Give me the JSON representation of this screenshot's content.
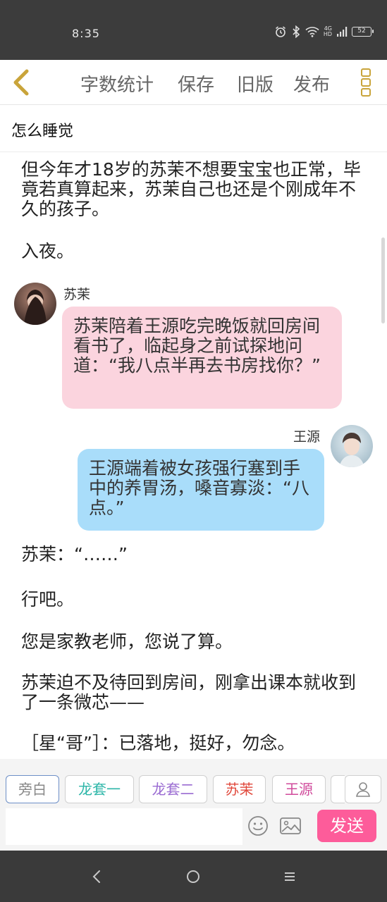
{
  "status_bar": {
    "time": "8:35",
    "network": "4G",
    "hd": "HD",
    "battery": "52"
  },
  "toolbar": {
    "back_icon": "chevron-left-icon",
    "word_count": "字数统计",
    "save": "保存",
    "old_version": "旧版",
    "publish": "发布",
    "more_icon": "three-square-menu-icon"
  },
  "chapter": {
    "title": "怎么睡觉"
  },
  "content": {
    "para1": "但今年才18岁的苏茉不想要宝宝也正常，毕竟若真算起来，苏茉自己也还是个刚成年不久的孩子。",
    "para2": "入夜。",
    "msg1": {
      "speaker": "苏茉",
      "text": "苏茉陪着王源吃完晚饭就回房间看书了，临起身之前试探地问道：“我八点半再去书房找你？”"
    },
    "msg2": {
      "speaker": "王源",
      "text": "王源端着被女孩强行塞到手中的养胃汤，嗓音寡淡：“八点。”"
    },
    "para3": "苏茉：“……”",
    "para4": "行吧。",
    "para5": "您是家教老师，您说了算。",
    "para6": "苏茉迫不及待回到房间，刚拿出课本就收到了一条微芯——",
    "para7": "［星“哥”］：已落地，挺好，勿念。"
  },
  "roles": {
    "narrator": "旁白",
    "role1": "龙套一",
    "role2": "龙套二",
    "role3": "苏茉",
    "role4": "王源",
    "manage_icon": "person-icon"
  },
  "composer": {
    "input_value": "",
    "emoji_icon": "smiley-icon",
    "image_icon": "image-icon",
    "send": "发送"
  },
  "nav": {
    "back_icon": "nav-back-icon",
    "home_icon": "nav-home-icon",
    "menu_icon": "nav-menu-icon"
  },
  "colors": {
    "accent": "#fd5c9a",
    "bubble_left": "#fbd4de",
    "bubble_right": "#a9ddfa",
    "toolbar_icon": "#c9a43a"
  }
}
